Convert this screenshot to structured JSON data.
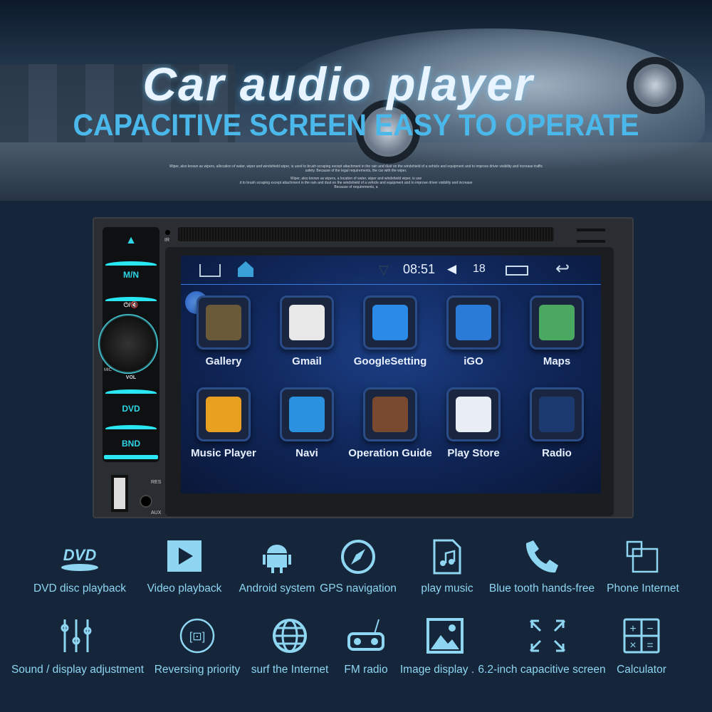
{
  "banner": {
    "title": "Car audio player",
    "subtitle": "CAPACITIVE SCREEN EASY TO OPERATE",
    "fine_print": [
      "Wiper, also known as wipers, allocation of water, wiper and windshield wiper, is used to brush scraping except attachment in the rain and dust on the windshield of a vehicle and equipment and to improve driver visibility and increase traffic safety. Because of the legal requirements, the car with the wiper.",
      "Wiper, also known as wipers, a location of water, wiper and windshield wiper, is use",
      "d to brush scraping except attachment in the rain and dust on the windshield of a vehicle and equipment and to improve driver visibility and increase",
      "Because of requirements, a"
    ]
  },
  "device": {
    "buttons": {
      "eject": "▲",
      "mn": "M/N",
      "power": "⏻/🔇",
      "vol": "VOL",
      "dvd": "DVD",
      "bnd": "BND",
      "ir": "IR",
      "res": "RES",
      "aux": "AUX",
      "mic": "MIC"
    },
    "accent": "#28e6f2",
    "status_bar": {
      "time": "08:51",
      "volume": "18",
      "icons": [
        "home-outline-icon",
        "home-app-icon",
        "wifi-icon",
        "speaker-icon",
        "recent-apps-icon",
        "back-icon"
      ]
    },
    "apps": [
      {
        "label": "Gallery",
        "color": "#6b5a3a"
      },
      {
        "label": "Gmail",
        "color": "#e8e8e8"
      },
      {
        "label": "GoogleSetting",
        "color": "#2a8ae8"
      },
      {
        "label": "iGO",
        "color": "#2a7ad8"
      },
      {
        "label": "Maps",
        "color": "#4aa860"
      },
      {
        "label": "Music Player",
        "color": "#e8a020"
      },
      {
        "label": "Navi",
        "color": "#2a90e0"
      },
      {
        "label": "Operation Guide",
        "color": "#7a4a30"
      },
      {
        "label": "Play Store",
        "color": "#e8eef4"
      },
      {
        "label": "Radio",
        "color": "#1a3a70"
      }
    ]
  },
  "features": [
    {
      "label": "DVD disc playback",
      "icon": "dvd-icon"
    },
    {
      "label": "Video playback",
      "icon": "play-icon"
    },
    {
      "label": "Android system",
      "icon": "android-icon"
    },
    {
      "label": "GPS navigation",
      "icon": "compass-icon"
    },
    {
      "label": "play music",
      "icon": "music-file-icon"
    },
    {
      "label": "Blue tooth hands-free",
      "icon": "phone-icon"
    },
    {
      "label": "Phone Internet",
      "icon": "mirror-link-icon"
    },
    {
      "label": "Sound / display adjustment",
      "icon": "sliders-icon"
    },
    {
      "label": "Reversing priority",
      "icon": "reverse-camera-icon"
    },
    {
      "label": "surf the Internet",
      "icon": "globe-icon"
    },
    {
      "label": "FM radio",
      "icon": "radio-icon"
    },
    {
      "label": "Image display .",
      "icon": "image-icon"
    },
    {
      "label": "6.2-inch capacitive screen",
      "icon": "fullscreen-icon"
    },
    {
      "label": "Calculator",
      "icon": "calculator-icon"
    }
  ],
  "feature_color": "#8ed6f2"
}
